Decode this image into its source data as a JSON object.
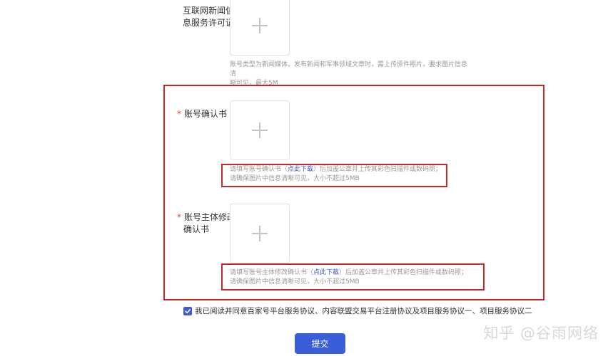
{
  "license": {
    "label_line1": "互联网新闻信",
    "label_line2": "息服务许可证",
    "hint_line1": "账号类型为新闻媒体，发布新闻和军事领域文章时，需上传原件照片，要求图片信息清",
    "hint_line2": "晰可见，最大5M"
  },
  "confirm": {
    "required_mark": "*",
    "label": "账号确认书",
    "hint_pre": "请填写账号确认书（",
    "hint_link": "点此下载",
    "hint_post": "）后加盖公章并上传其彩色扫描件或数码照；",
    "hint_line2": "请确保图片中信息清晰可见，大小不超过5MB"
  },
  "modify": {
    "required_mark": "*",
    "label_line1": "账号主体修改",
    "label_line2": "确认书",
    "hint_pre": "请填写账号主体修改确认书（",
    "hint_link": "点此下载",
    "hint_post": "）后加盖公章并上传其彩色扫描件或数码照；",
    "hint_line2": "请确保图片中信息清晰可见，大小不超过5MB"
  },
  "agreement": {
    "checked": true,
    "text": "我已阅读并同意百家号平台服务协议、内容联盟交易平台注册协议及项目服务协议一、项目服务协议二"
  },
  "submit_label": "提交",
  "watermark": "知乎 @谷雨网络",
  "colors": {
    "accent": "#3a5ed8",
    "highlight_border": "#c62828",
    "required": "#e63b3b"
  }
}
